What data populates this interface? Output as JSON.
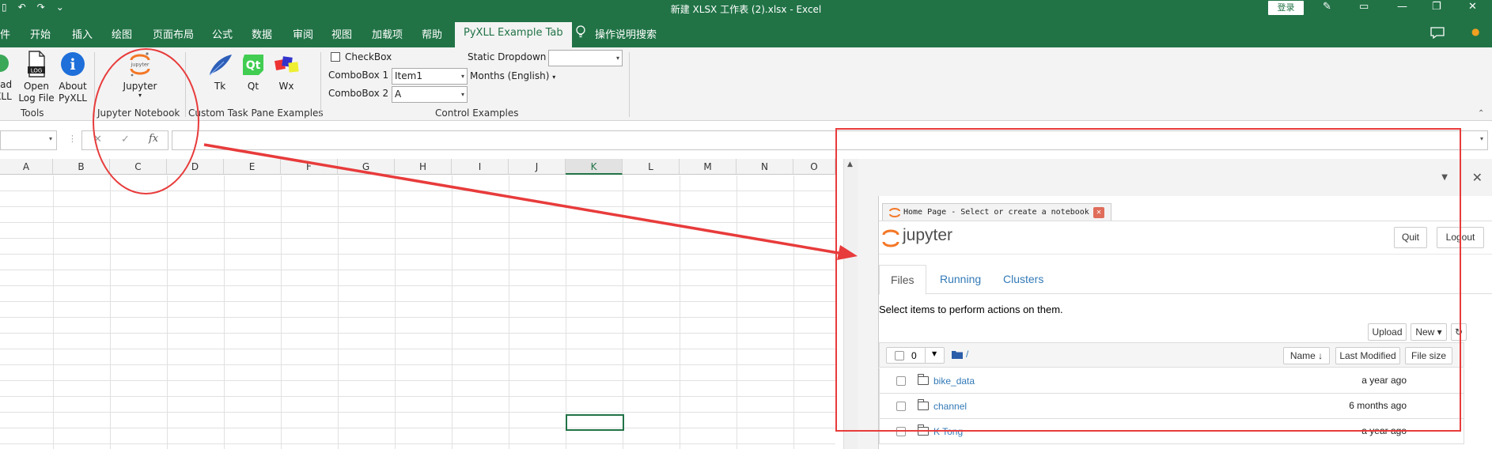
{
  "window": {
    "title": "新建 XLSX 工作表 (2).xlsx  -  Excel",
    "login_label": "登录",
    "quick_access": [
      "↶",
      "↷",
      "⌄"
    ],
    "controls": {
      "pen": "✎",
      "restore_ribbon": "▭",
      "minimize": "—",
      "maximize": "❐",
      "close": "✕"
    }
  },
  "menu": {
    "tabs": [
      "件",
      "开始",
      "插入",
      "绘图",
      "页面布局",
      "公式",
      "数据",
      "审阅",
      "视图",
      "加载项",
      "帮助",
      "PyXLL Example Tab"
    ],
    "active_tab": "PyXLL Example Tab",
    "search_label": "操作说明搜索",
    "comment_icon": "comment-icon"
  },
  "ribbon": {
    "tools": {
      "buttons": [
        {
          "line1": "oad",
          "line2": "XLL"
        },
        {
          "line1": "Open",
          "line2": "Log File"
        },
        {
          "line1": "About",
          "line2": "PyXLL"
        }
      ],
      "log_badge": "LOG",
      "info_glyph": "i",
      "label": "Tools"
    },
    "jupyter": {
      "button": "Jupyter",
      "icon_text": "jupyter",
      "label": "Jupyter Notebook"
    },
    "task_pane": {
      "buttons": [
        "Tk",
        "Qt",
        "Wx"
      ],
      "label": "Custom Task Pane Examples"
    },
    "controls": {
      "checkbox_label": "CheckBox",
      "combo1_label": "ComboBox 1",
      "combo1_value": "Item1",
      "combo2_label": "ComboBox 2",
      "combo2_value": "A",
      "static_dropdown_label": "Static Dropdown",
      "months_label": "Months (English)",
      "label": "Control Examples"
    }
  },
  "formula_bar": {
    "name_box": "",
    "cancel": "✕",
    "enter": "✓",
    "fx": "fx",
    "value": ""
  },
  "grid": {
    "columns": [
      "A",
      "B",
      "C",
      "D",
      "E",
      "F",
      "G",
      "H",
      "I",
      "J",
      "K",
      "L",
      "M",
      "N",
      "O"
    ],
    "selected_column": "K"
  },
  "jupyter_pane": {
    "tab_title": "Home Page - Select or create a notebook",
    "tab_close": "✕",
    "logo_text": "jupyter",
    "quit_label": "Quit",
    "logout_label": "Logout",
    "tabs": [
      "Files",
      "Running",
      "Clusters"
    ],
    "active_tab": "Files",
    "instruction": "Select items to perform actions on them.",
    "upload_label": "Upload",
    "new_label": "New ▾",
    "refresh_glyph": "↻",
    "selected_count": "0",
    "path": "/",
    "sort_name_label": "Name ↓",
    "last_modified_label": "Last Modified",
    "file_size_label": "File size",
    "rows": [
      {
        "name": "bike_data",
        "modified": "a year ago"
      },
      {
        "name": "channel",
        "modified": "6 months ago"
      },
      {
        "name": "K Tong",
        "modified": "a year ago"
      }
    ]
  },
  "colors": {
    "excel_green": "#217346",
    "annotation_red": "#e83b3b",
    "jupyter_orange": "#f37726",
    "link_blue": "#337ab7"
  }
}
